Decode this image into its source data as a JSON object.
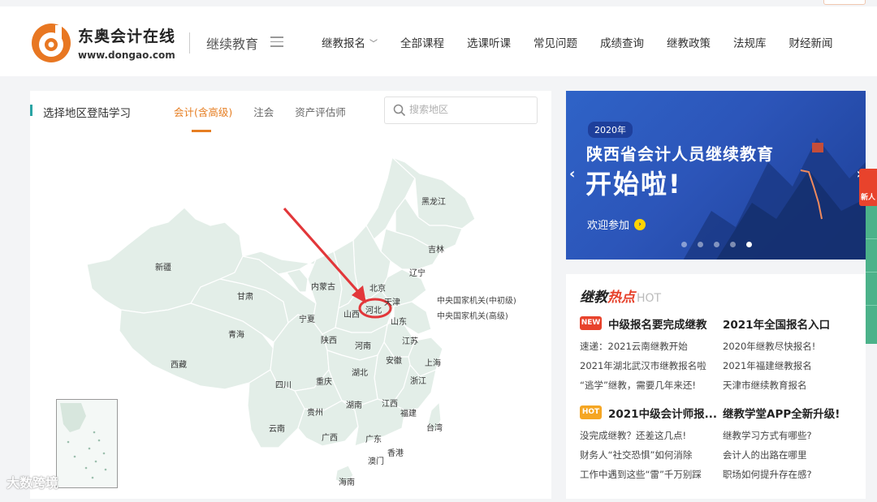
{
  "header": {
    "brand_cn": "东奥会计在线",
    "brand_url": "www.dongao.com",
    "sub_title": "继续教育",
    "nav": [
      {
        "label": "继教报名",
        "has_dropdown": true
      },
      {
        "label": "全部课程"
      },
      {
        "label": "选课听课"
      },
      {
        "label": "常见问题"
      },
      {
        "label": "成绩查询"
      },
      {
        "label": "继教政策"
      },
      {
        "label": "法规库"
      },
      {
        "label": "财经新闻"
      }
    ]
  },
  "region_panel": {
    "title": "选择地区登陆学习",
    "tabs": [
      "会计(含高级)",
      "注会",
      "资产评估师"
    ],
    "active_tab": 0,
    "search_placeholder": "搜索地区",
    "provinces": [
      "黑龙江",
      "吉林",
      "辽宁",
      "新疆",
      "内蒙古",
      "北京",
      "天津",
      "河北",
      "甘肃",
      "宁夏",
      "山西",
      "山东",
      "青海",
      "陕西",
      "河南",
      "江苏",
      "安徽",
      "上海",
      "西藏",
      "湖北",
      "四川",
      "重庆",
      "浙江",
      "贵州",
      "湖南",
      "江西",
      "福建",
      "云南",
      "广西",
      "广东",
      "台湾",
      "香港",
      "澳门",
      "海南"
    ],
    "central": [
      "中央国家机关(中初级)",
      "中央国家机关(高级)"
    ],
    "highlighted": "河北",
    "map_fill": "#e3eee8",
    "map_stroke": "#ffffff",
    "accent": "#e67e22",
    "annotation_color": "#e2373a"
  },
  "banner": {
    "year": "2020年",
    "headline": "陕西省会计人员继续教育",
    "big_text": "开始啦!",
    "cta": "欢迎参加",
    "slide_count": 5,
    "active_slide": 4
  },
  "hot": {
    "title_a": "继教",
    "title_b": "热点",
    "title_en": "HOT",
    "block1": {
      "badge": "NEW",
      "left_head": "中级报名要完成继教",
      "right_head": "2021年全国报名入口",
      "left_links": [
        "速递：2021云南继教开始",
        "2021年湖北武汉市继教报名啦",
        "“逃学”继教，需要几年来还!"
      ],
      "right_links": [
        "2020年继教尽快报名!",
        "2021年福建继教报名",
        "天津市继续教育报名"
      ]
    },
    "block2": {
      "badge": "HOT",
      "left_head": "2021中级会计师报...",
      "right_head": "继教学堂APP全新升级!",
      "left_links": [
        "没完成继教？还差这几点!",
        "财务人“社交恐惧”如何消除",
        "工作中遇到这些“雷”千万别踩"
      ],
      "right_links": [
        "继教学习方式有哪些?",
        "会计人的出路在哪里",
        "职场如何提升存在感?"
      ]
    }
  },
  "side": {
    "gift_label": "新人"
  },
  "watermark": "大数跨境"
}
